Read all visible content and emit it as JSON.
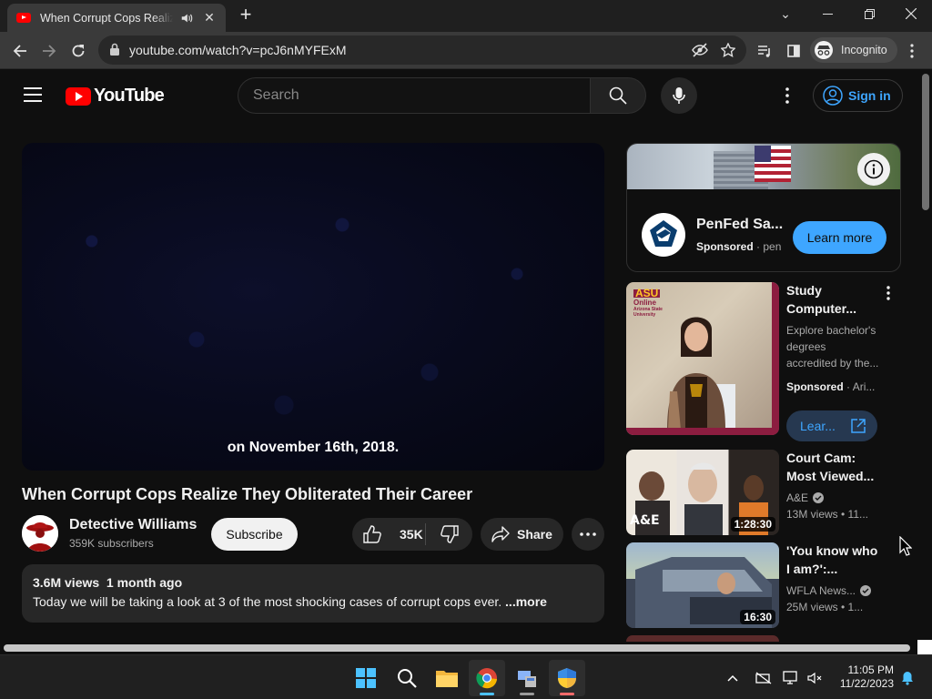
{
  "browser": {
    "tab_title": "When Corrupt Cops Realize They Obliterated Their Career - YouTube",
    "url": "youtube.com/watch?v=pcJ6nMYFExM",
    "incognito_label": "Incognito"
  },
  "youtube": {
    "logo_text": "YouTube",
    "search_placeholder": "Search",
    "signin_label": "Sign in"
  },
  "player": {
    "caption": "on November 16th, 2018."
  },
  "video": {
    "title": "When Corrupt Cops Realize They Obliterated Their Career",
    "channel": "Detective Williams",
    "subscribers": "359K subscribers",
    "subscribe_label": "Subscribe",
    "likes": "35K",
    "share_label": "Share",
    "views_date": "3.6M views  1 month ago",
    "description": "Today we will be taking a look at 3 of the most shocking cases of corrupt cops ever. ",
    "more_label": "...more"
  },
  "sidebar": {
    "ad": {
      "name": "PenFed Sa...",
      "sponsored": "Sponsored",
      "advertiser": "pen",
      "cta": "Learn more"
    },
    "promo": {
      "title_line1": "Study",
      "title_line2": "Computer...",
      "desc_line1": "Explore bachelor's",
      "desc_line2": "degrees",
      "desc_line3": "accredited by the...",
      "sponsored": "Sponsored",
      "advertiser": "Ari...",
      "cta": "Lear...",
      "thumb_logo_top": "ASU",
      "thumb_logo_mid": "Online",
      "thumb_logo_bottom": "Arizona State University"
    },
    "videos": [
      {
        "title_line1": "Court Cam:",
        "title_line2": "Most Viewed...",
        "channel": "A&E",
        "meta": "13M views • 11...",
        "duration": "1:28:30",
        "thumb_text": "A&E"
      },
      {
        "title_line1": "'You know who",
        "title_line2": "I am?':...",
        "channel": "WFLA News...",
        "meta": "25M views • 1...",
        "duration": "16:30"
      }
    ]
  },
  "taskbar": {
    "time": "11:05 PM",
    "date": "11/22/2023"
  },
  "colors": {
    "yt_red": "#ff0000",
    "link_blue": "#3ea6ff",
    "asu_maroon": "#8c1d40",
    "asu_gold": "#ffc627",
    "page_bg": "#0f0f0f"
  }
}
